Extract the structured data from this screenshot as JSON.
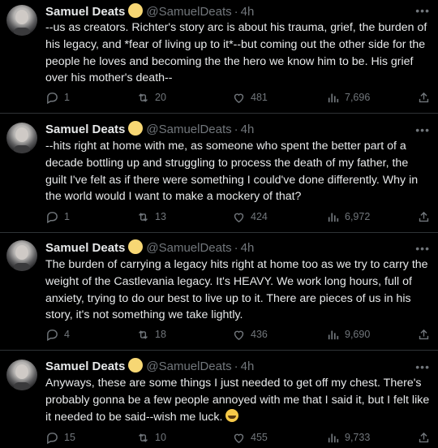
{
  "tweets": [
    {
      "name": "Samuel Deats",
      "handle": "@SamuelDeats",
      "separator": "·",
      "time": "4h",
      "text": "--us as creators. Richter's story arc is about his trauma, grief, the burden of his legacy, and *fear of living up to it*--but coming out the other side for the people he loves and becoming the the hero we know him to be. His grief over his mother's death--",
      "replies": "1",
      "retweets": "20",
      "likes": "481",
      "views": "7,696"
    },
    {
      "name": "Samuel Deats",
      "handle": "@SamuelDeats",
      "separator": "·",
      "time": "4h",
      "text": "--hits right at home with me, as someone who spent the better part of a decade bottling up and struggling to process the death of my father, the guilt I've felt as if there were something I could've done differently. Why in the world would I want to make a mockery of that?",
      "replies": "1",
      "retweets": "13",
      "likes": "424",
      "views": "6,972"
    },
    {
      "name": "Samuel Deats",
      "handle": "@SamuelDeats",
      "separator": "·",
      "time": "4h",
      "text": "The burden of carrying a legacy hits right at home too as we try to carry the weight of the Castlevania legacy. It's HEAVY. We work long hours, full of anxiety, trying to do our best to live up to it. There are pieces of us in his story, it's not something we take lightly.",
      "replies": "4",
      "retweets": "18",
      "likes": "436",
      "views": "9,690"
    },
    {
      "name": "Samuel Deats",
      "handle": "@SamuelDeats",
      "separator": "·",
      "time": "4h",
      "text": "Anyways, these are some things I just needed to get off my chest. There's probably gonna be a few people annoyed with me that I said it, but I felt like it needed to be said--wish me luck.",
      "replies": "15",
      "retweets": "10",
      "likes": "455",
      "views": "9,733"
    }
  ],
  "icons": {
    "more": "more-icon",
    "reply": "reply-icon",
    "retweet": "retweet-icon",
    "like": "heart-icon",
    "views": "views-icon",
    "share": "share-icon",
    "badge": "verified-badge-icon",
    "emoji": "sweat-smile-emoji-icon"
  },
  "colors": {
    "background": "#000000",
    "text": "#e7e9ea",
    "muted": "#71767b",
    "divider": "#2f3336",
    "badge": "#f7d774"
  }
}
